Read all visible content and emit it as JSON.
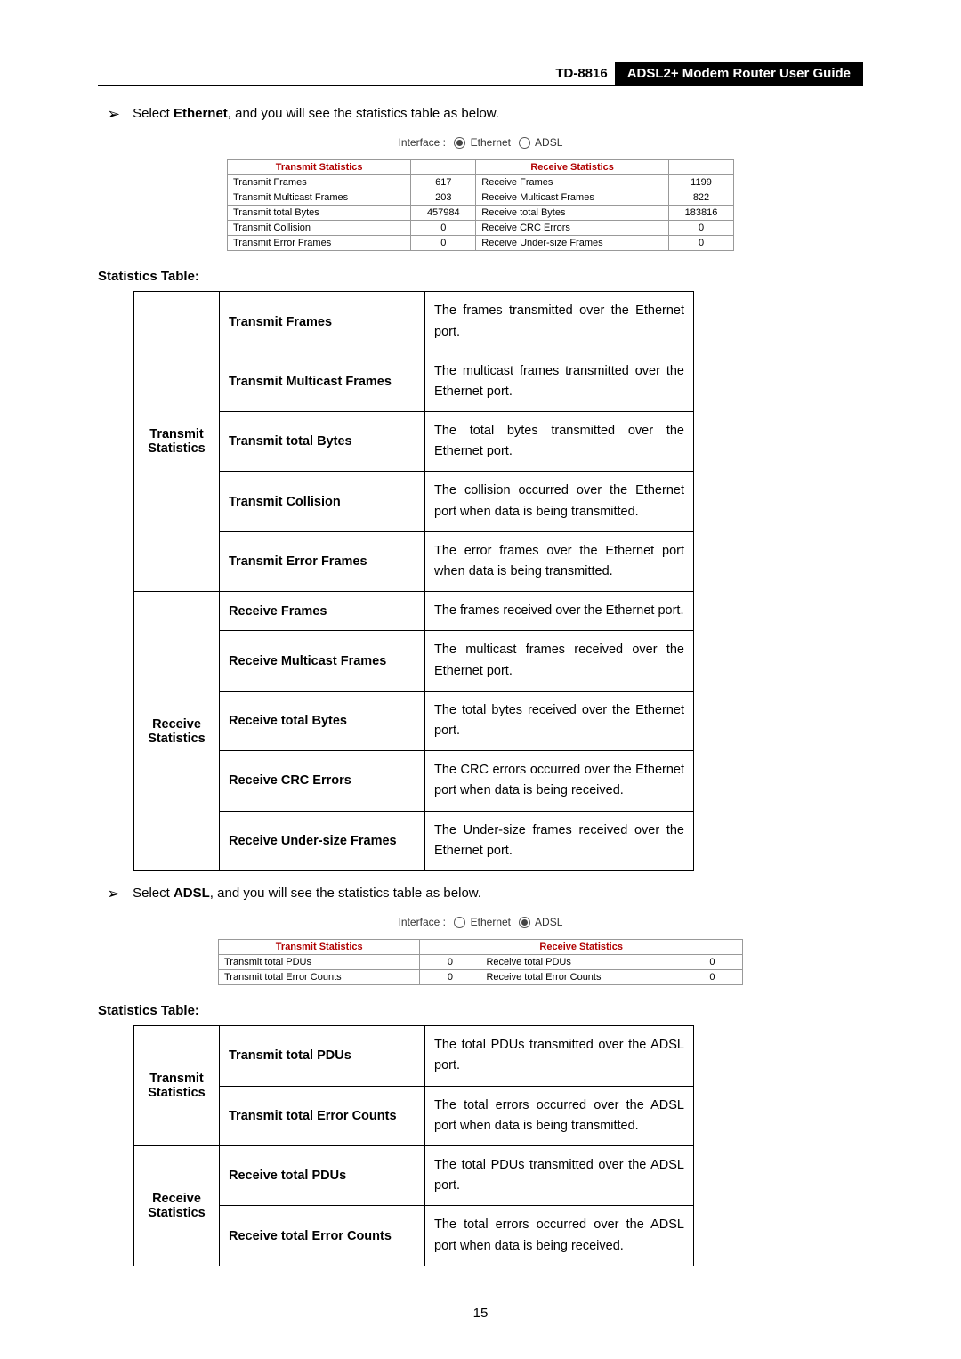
{
  "header": {
    "model": "TD-8816",
    "title": "ADSL2+  Modem  Router  User  Guide"
  },
  "bullet1_pre": "Select ",
  "bullet1_bold": "Ethernet",
  "bullet1_post": ", and you will see the statistics table as below.",
  "interface_label": "Interface :",
  "eth_label": "Ethernet",
  "adsl_label": "ADSL",
  "eth_stats": {
    "tx_header": "Transmit Statistics",
    "rx_header": "Receive Statistics",
    "rows": [
      {
        "tx_name": "Transmit Frames",
        "tx_val": "617",
        "rx_name": "Receive Frames",
        "rx_val": "1199"
      },
      {
        "tx_name": "Transmit Multicast Frames",
        "tx_val": "203",
        "rx_name": "Receive Multicast Frames",
        "rx_val": "822"
      },
      {
        "tx_name": "Transmit total Bytes",
        "tx_val": "457984",
        "rx_name": "Receive total Bytes",
        "rx_val": "183816"
      },
      {
        "tx_name": "Transmit Collision",
        "tx_val": "0",
        "rx_name": "Receive CRC Errors",
        "rx_val": "0"
      },
      {
        "tx_name": "Transmit Error Frames",
        "tx_val": "0",
        "rx_name": "Receive Under-size Frames",
        "rx_val": "0"
      }
    ]
  },
  "stat_label": "Statistics Table:",
  "eth_desc": {
    "tx_group": "Transmit Statistics",
    "rx_group": "Receive Statistics",
    "tx_rows": [
      {
        "name": "Transmit Frames",
        "desc": "The frames transmitted over the Ethernet port."
      },
      {
        "name": "Transmit Multicast Frames",
        "desc": "The multicast frames transmitted over the Ethernet port."
      },
      {
        "name": "Transmit total Bytes",
        "desc": "The total bytes transmitted over the Ethernet port."
      },
      {
        "name": "Transmit Collision",
        "desc": "The collision occurred over the Ethernet port when data is being transmitted."
      },
      {
        "name": "Transmit Error Frames",
        "desc": "The error frames over the Ethernet port when data is being transmitted."
      }
    ],
    "rx_rows": [
      {
        "name": "Receive Frames",
        "desc": "The frames received over the Ethernet port."
      },
      {
        "name": "Receive Multicast Frames",
        "desc": "The multicast frames received over the Ethernet port."
      },
      {
        "name": "Receive total Bytes",
        "desc": "The total bytes received over the Ethernet port."
      },
      {
        "name": "Receive CRC Errors",
        "desc": "The CRC errors occurred over the Ethernet port when data is being received."
      },
      {
        "name": "Receive Under-size Frames",
        "desc": "The Under-size frames received over the Ethernet port."
      }
    ]
  },
  "bullet2_pre": "Select ",
  "bullet2_bold": "ADSL",
  "bullet2_post": ", and you will see the statistics table as below.",
  "adsl_stats": {
    "tx_header": "Transmit Statistics",
    "rx_header": "Receive Statistics",
    "rows": [
      {
        "tx_name": "Transmit total PDUs",
        "tx_val": "0",
        "rx_name": "Receive total PDUs",
        "rx_val": "0"
      },
      {
        "tx_name": "Transmit total Error Counts",
        "tx_val": "0",
        "rx_name": "Receive total Error Counts",
        "rx_val": "0"
      }
    ]
  },
  "adsl_desc": {
    "tx_group": "Transmit Statistics",
    "rx_group": "Receive Statistics",
    "tx_rows": [
      {
        "name": "Transmit total PDUs",
        "desc": "The total PDUs transmitted over the ADSL port."
      },
      {
        "name": "Transmit total Error Counts",
        "desc": "The total errors occurred over the ADSL port when data is being transmitted."
      }
    ],
    "rx_rows": [
      {
        "name": "Receive total PDUs",
        "desc": "The total PDUs transmitted over the ADSL port."
      },
      {
        "name": "Receive total Error Counts",
        "desc": "The total errors occurred over the ADSL port when data is being received."
      }
    ]
  },
  "page_number": "15"
}
